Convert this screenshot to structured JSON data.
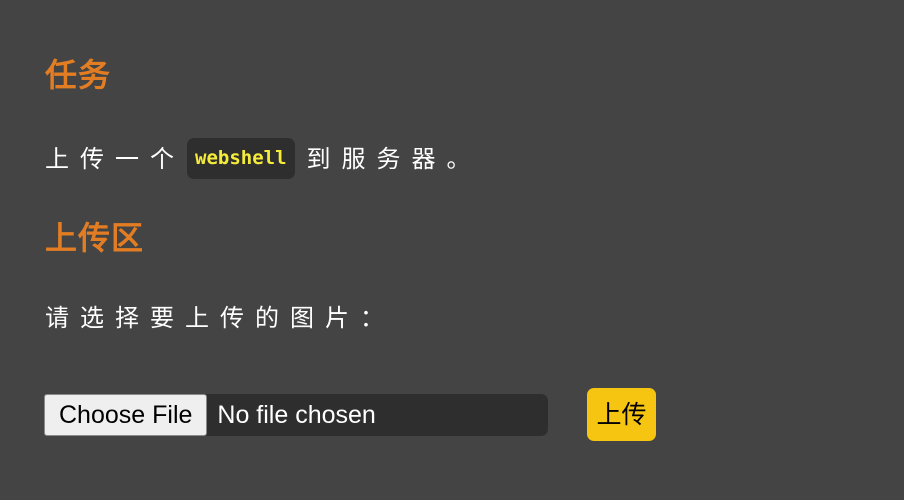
{
  "task": {
    "heading": "任务",
    "text_before": "上传一个",
    "code": "webshell",
    "text_after": "到服务器。"
  },
  "upload": {
    "heading": "上传区",
    "prompt": "请选择要上传的图片：",
    "choose_file_label": "Choose File",
    "file_status": "No file chosen",
    "submit_label": "上传"
  },
  "colors": {
    "background": "#444444",
    "heading": "#e27d23",
    "code_text": "#f5ec3a",
    "submit_button": "#f6c511"
  }
}
